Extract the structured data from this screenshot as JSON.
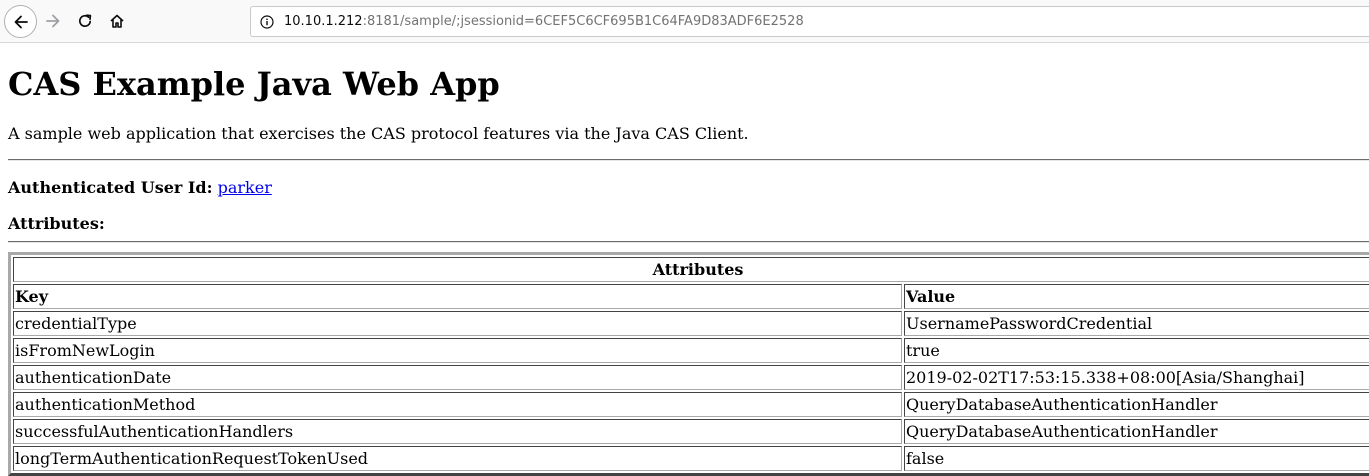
{
  "browser": {
    "url_host": "10.10.1.212",
    "url_rest": ":8181/sample/;jsessionid=6CEF5C6CF695B1C64FA9D83ADF6E2528"
  },
  "page": {
    "title": "CAS Example Java Web App",
    "description": "A sample web application that exercises the CAS protocol features via the Java CAS Client.",
    "user_label": "Authenticated User Id:",
    "user_id": "parker",
    "attributes_heading": "Attributes:"
  },
  "table": {
    "caption": "Attributes",
    "key_header": "Key",
    "value_header": "Value",
    "rows": [
      {
        "key": "credentialType",
        "value": "UsernamePasswordCredential"
      },
      {
        "key": "isFromNewLogin",
        "value": "true"
      },
      {
        "key": "authenticationDate",
        "value": "2019-02-02T17:53:15.338+08:00[Asia/Shanghai]"
      },
      {
        "key": "authenticationMethod",
        "value": "QueryDatabaseAuthenticationHandler"
      },
      {
        "key": "successfulAuthenticationHandlers",
        "value": "QueryDatabaseAuthenticationHandler"
      },
      {
        "key": "longTermAuthenticationRequestTokenUsed",
        "value": "false"
      }
    ]
  }
}
